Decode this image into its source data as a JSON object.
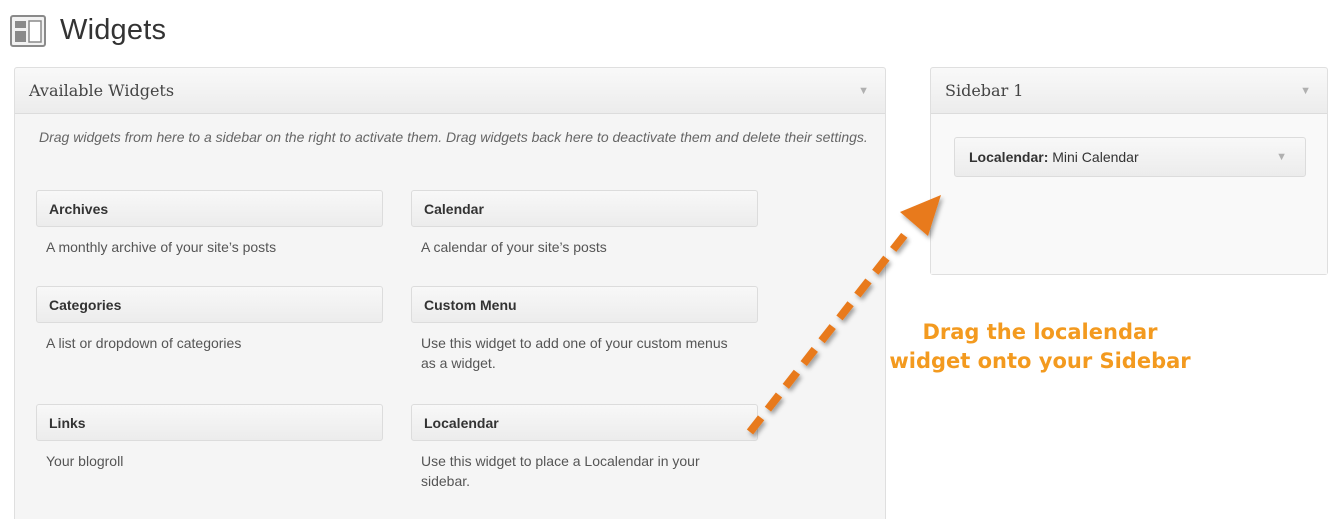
{
  "page": {
    "title": "Widgets",
    "icon": "widgets-icon"
  },
  "available_widgets": {
    "title": "Available Widgets",
    "toggle_icon": "triangle-down-icon",
    "description": "Drag widgets from here to a sidebar on the right to activate them. Drag widgets back here to deactivate them and delete their settings.",
    "widgets": [
      {
        "title": "Archives",
        "description": "A monthly archive of your site’s posts"
      },
      {
        "title": "Calendar",
        "description": "A calendar of your site’s posts"
      },
      {
        "title": "Categories",
        "description": "A list or dropdown of categories"
      },
      {
        "title": "Custom Menu",
        "description": "Use this widget to add one of your custom menus as a widget."
      },
      {
        "title": "Links",
        "description": "Your blogroll"
      },
      {
        "title": "Localendar",
        "description": "Use this widget to place a Localendar in your sidebar."
      }
    ]
  },
  "sidebar": {
    "title": "Sidebar 1",
    "toggle_icon": "triangle-down-icon",
    "widget": {
      "name": "Localendar:",
      "subtitle": "Mini Calendar"
    }
  },
  "annotation": {
    "line1": "Drag the localendar",
    "line2": "widget onto your Sidebar",
    "color": "#f39a1f"
  }
}
